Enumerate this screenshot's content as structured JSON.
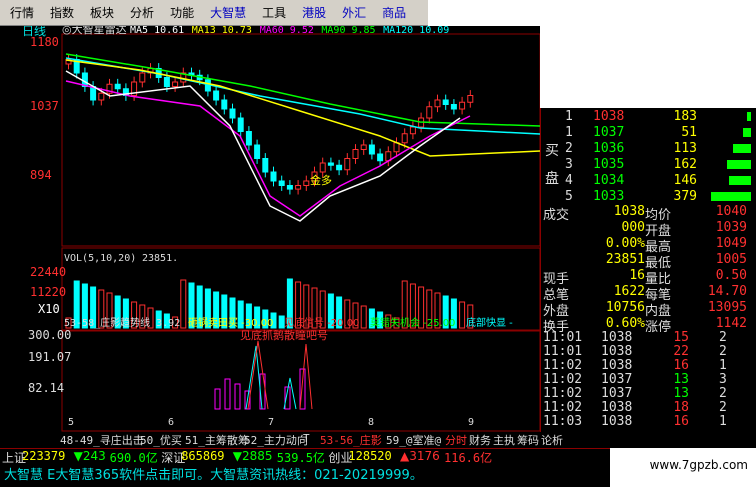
{
  "menu": [
    {
      "label": "行情",
      "active": false
    },
    {
      "label": "指数",
      "active": false
    },
    {
      "label": "板块",
      "active": false
    },
    {
      "label": "分析",
      "active": false
    },
    {
      "label": "功能",
      "active": false
    },
    {
      "label": "大智慧",
      "active": true
    },
    {
      "label": "工具",
      "active": false
    },
    {
      "label": "港股",
      "active": true
    },
    {
      "label": "外汇",
      "active": true
    },
    {
      "label": "商品",
      "active": true
    }
  ],
  "kline": {
    "period": "日线",
    "indicator_title": "◎大智星雷达",
    "ma_legend": [
      {
        "label": "MA5",
        "value": "10.61",
        "color": "#ffffff"
      },
      {
        "label": "MA13",
        "value": "10.73",
        "color": "#ffff00"
      },
      {
        "label": "MA60",
        "value": "9.52",
        "color": "#ff00ff"
      },
      {
        "label": "MA90",
        "value": "9.85",
        "color": "#00ff00"
      },
      {
        "label": "MA120",
        "value": "10.09",
        "color": "#00ffff"
      }
    ],
    "price_axis": [
      "1180",
      "1037",
      "894"
    ],
    "marker_label": "金多"
  },
  "volume": {
    "legend": "VOL(5,10,20)",
    "value": "23851.",
    "axis": [
      "22440",
      "11220"
    ],
    "unit": "X10"
  },
  "signal": {
    "title": "53-58_庄影趋势线",
    "value": "3.92",
    "items": [
      {
        "label": "砸锅卖田买",
        "value": "-30.00",
        "color": "#ffff00"
      },
      {
        "label": "见底信号",
        "value": "-20.00",
        "color": "#ff3030"
      },
      {
        "label": "莫错失机会",
        "value": "-25.00",
        "color": "#00ff00"
      },
      {
        "label": "底部快显",
        "value": "-",
        "color": "#00ffff"
      }
    ],
    "axis": [
      "300.00",
      "191.07",
      "82.14"
    ],
    "annotation": "见底抓鹅散瞳吧号",
    "dates": [
      "5",
      "6",
      "7",
      "8",
      "9"
    ]
  },
  "orderbook": {
    "buy_label": "买",
    "pan_label": "盘",
    "rows": [
      {
        "level": "1",
        "price": "1038",
        "vol": "183"
      },
      {
        "level": "1",
        "price": "1037",
        "vol": "51"
      },
      {
        "level": "2",
        "price": "1036",
        "vol": "113"
      },
      {
        "level": "3",
        "price": "1035",
        "vol": "162"
      },
      {
        "level": "4",
        "price": "1034",
        "vol": "146"
      },
      {
        "level": "5",
        "price": "1033",
        "vol": "379"
      }
    ],
    "bar_levels": [
      0.1,
      0.2,
      0.45,
      0.6,
      0.55,
      1.0
    ]
  },
  "stats": [
    {
      "l1": "成交",
      "v1": "1038",
      "l2": "均价",
      "v2": "1040"
    },
    {
      "l1": "",
      "v1": "000",
      "l2": "开盘",
      "v2": "1039"
    },
    {
      "l1": "",
      "v1": "0.00%",
      "l2": "最高",
      "v2": "1049"
    },
    {
      "l1": "",
      "v1": "23851",
      "l2": "最低",
      "v2": "1005"
    },
    {
      "l1": "现手",
      "v1": "16",
      "l2": "量比",
      "v2": "0.50"
    },
    {
      "l1": "总笔",
      "v1": "1622",
      "l2": "每笔",
      "v2": "14.70"
    },
    {
      "l1": "外盘",
      "v1": "10756",
      "l2": "内盘",
      "v2": "13095"
    },
    {
      "l1": "换手",
      "v1": "0.60%",
      "l2": "涨停",
      "v2": "1142"
    }
  ],
  "trades": [
    {
      "time": "11:01",
      "price": "1038",
      "vol": "15",
      "flag": "2"
    },
    {
      "time": "11:01",
      "price": "1038",
      "vol": "22",
      "flag": "2"
    },
    {
      "time": "11:02",
      "price": "1038",
      "vol": "16",
      "flag": "1"
    },
    {
      "time": "11:02",
      "price": "1037",
      "vol": "13",
      "flag": "3"
    },
    {
      "time": "11:02",
      "price": "1037",
      "vol": "13",
      "flag": "2"
    },
    {
      "time": "11:02",
      "price": "1038",
      "vol": "18",
      "flag": "2"
    },
    {
      "time": "11:03",
      "price": "1038",
      "vol": "16",
      "flag": "1"
    }
  ],
  "tabs": [
    {
      "label": "48-49_寻庄出击",
      "hl": false
    },
    {
      "label": "50_优买",
      "hl": false
    },
    {
      "label": "51_主筹散筹",
      "hl": false
    },
    {
      "label": "52_主力动向",
      "hl": false
    },
    {
      "label": "T",
      "hl": false
    },
    {
      "label": "53-56_庄影",
      "hl": true
    },
    {
      "label": "59_@室准@",
      "hl": false
    },
    {
      "label": "分时",
      "hl": true
    },
    {
      "label": "财务",
      "hl": false
    },
    {
      "label": "主执",
      "hl": false
    },
    {
      "label": "筹码",
      "hl": false
    },
    {
      "label": "论析",
      "hl": false
    }
  ],
  "indexbar": [
    {
      "label": "上证",
      "value": "223379",
      "color": "#ffff00"
    },
    {
      "label": "▼243",
      "value": "690.0亿",
      "color": "#00ff00"
    },
    {
      "label": "深证",
      "value": "865869",
      "color": "#ffff00"
    },
    {
      "label": "▼2885",
      "value": "539.5亿",
      "color": "#00ff00"
    },
    {
      "label": "创业",
      "value": "128520",
      "color": "#ffff00"
    },
    {
      "label": "▲3176",
      "value": "116.6亿",
      "color": "#ff3030"
    }
  ],
  "status": "大智慧 E大智慧365软件点击即可。大智慧资讯热线：021-20219999。",
  "watermark": "www.7gpzb.com"
}
